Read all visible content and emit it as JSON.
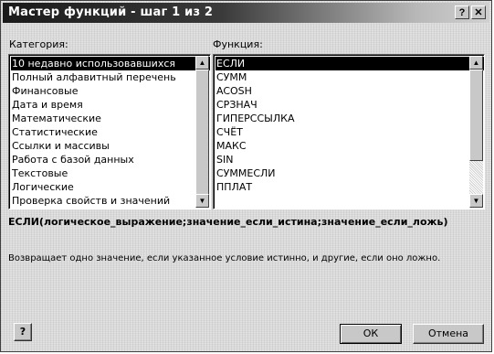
{
  "window": {
    "title": "Мастер функций - шаг 1 из 2",
    "help_glyph": "?",
    "close_glyph": "✕"
  },
  "category": {
    "label": "Категория:",
    "items": [
      "10 недавно использовавшихся",
      "Полный алфавитный перечень",
      "Финансовые",
      "Дата и время",
      "Математические",
      "Статистические",
      "Ссылки и массивы",
      "Работа с базой данных",
      "Текстовые",
      "Логические",
      "Проверка свойств и значений"
    ],
    "selected_index": 0
  },
  "function": {
    "label": "Функция:",
    "items": [
      "ЕСЛИ",
      "СУММ",
      "ACOSH",
      "СРЗНАЧ",
      "ГИПЕРССЫЛКА",
      "СЧЁТ",
      "МАКС",
      "SIN",
      "СУММЕСЛИ",
      "ППЛАТ"
    ],
    "selected_index": 0
  },
  "syntax": "ЕСЛИ(логическое_выражение;значение_если_истина;значение_если_ложь)",
  "description": "Возвращает одно значение, если указанное условие истинно, и другие, если оно ложно.",
  "buttons": {
    "help_icon": "?",
    "ok": "ОК",
    "cancel": "Отмена"
  },
  "icons": {
    "scroll_up": "▲",
    "scroll_down": "▼"
  }
}
